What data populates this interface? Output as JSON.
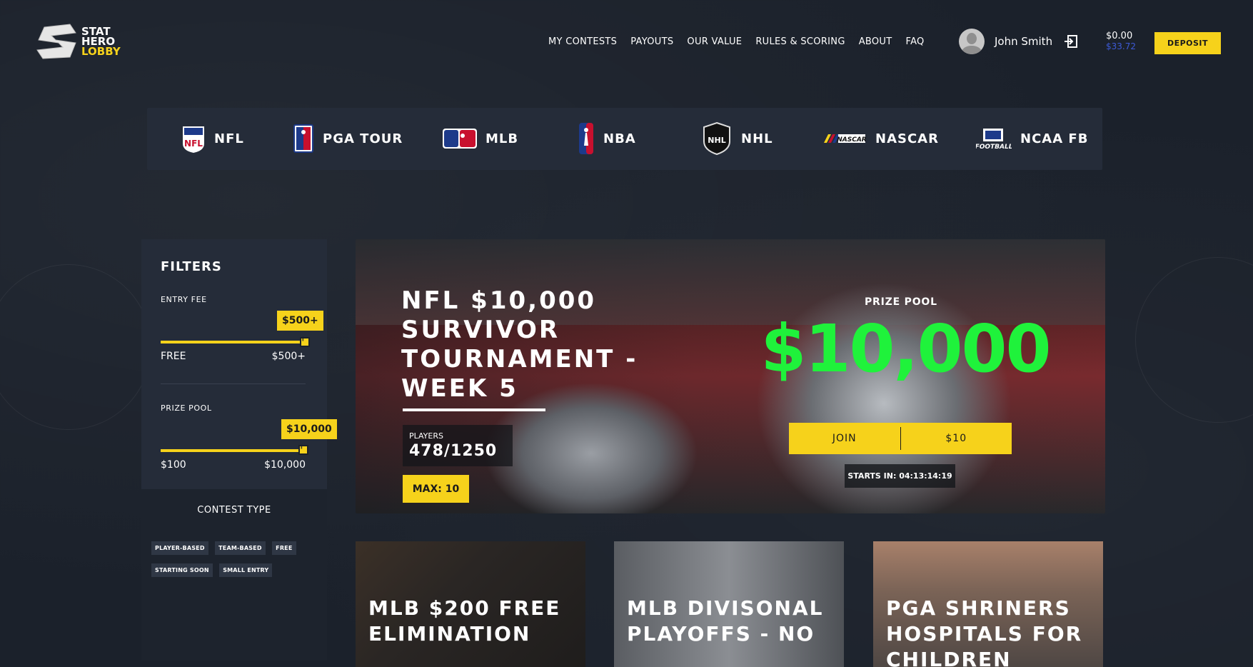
{
  "logo": {
    "line1": "STAT",
    "line2": "HERO",
    "line3": "LOBBY"
  },
  "nav": [
    "MY CONTESTS",
    "PAYOUTS",
    "OUR VALUE",
    "RULES & SCORING",
    "ABOUT",
    "FAQ"
  ],
  "user": {
    "name": "John Smith",
    "balance": "$0.00",
    "bonus": "$33.72",
    "deposit_label": "DEPOSIT"
  },
  "sports": [
    {
      "label": "NFL",
      "icon": "nfl-shield-icon"
    },
    {
      "label": "PGA TOUR",
      "icon": "pga-tour-icon"
    },
    {
      "label": "MLB",
      "icon": "mlb-icon"
    },
    {
      "label": "NBA",
      "icon": "nba-icon"
    },
    {
      "label": "NHL",
      "icon": "nhl-icon"
    },
    {
      "label": "NASCAR",
      "icon": "nascar-icon"
    },
    {
      "label": "NCAA FB",
      "icon": "ncaa-football-icon"
    }
  ],
  "filters": {
    "title": "FILTERS",
    "entry_fee": {
      "label": "ENTRY FEE",
      "tooltip": "$500+",
      "min": "FREE",
      "max": "$500+",
      "level": 1.0
    },
    "prize_pool": {
      "label": "PRIZE POOL",
      "tooltip": "$10,000",
      "min": "$100",
      "max": "$10,000",
      "level": 1.0
    },
    "contest_type": {
      "title": "CONTEST TYPE",
      "tags": [
        "PLAYER-BASED",
        "TEAM-BASED",
        "FREE",
        "STARTING SOON",
        "SMALL ENTRY"
      ]
    }
  },
  "hero": {
    "title": "NFL $10,000 SURVIVOR TOURNAMENT - WEEK 5",
    "players_label": "PLAYERS",
    "players_value": "478/1250",
    "max_label": "MAX: 10",
    "prize_label": "PRIZE POOL",
    "prize_value": "$10,000",
    "join_label": "JOIN",
    "entry_label": "$10",
    "starts": "STARTS IN: 04:13:14:19"
  },
  "cards": [
    {
      "title": "MLB $200 FREE ELIMINATION"
    },
    {
      "title": "MLB DIVISONAL PLAYOFFS - NO"
    },
    {
      "title": "PGA SHRINERS HOSPITALS FOR CHILDREN"
    }
  ],
  "colors": {
    "accent": "#f6d21b",
    "prize": "#1ff23b",
    "panel": "#252c39",
    "bonus": "#3d5ad6"
  }
}
